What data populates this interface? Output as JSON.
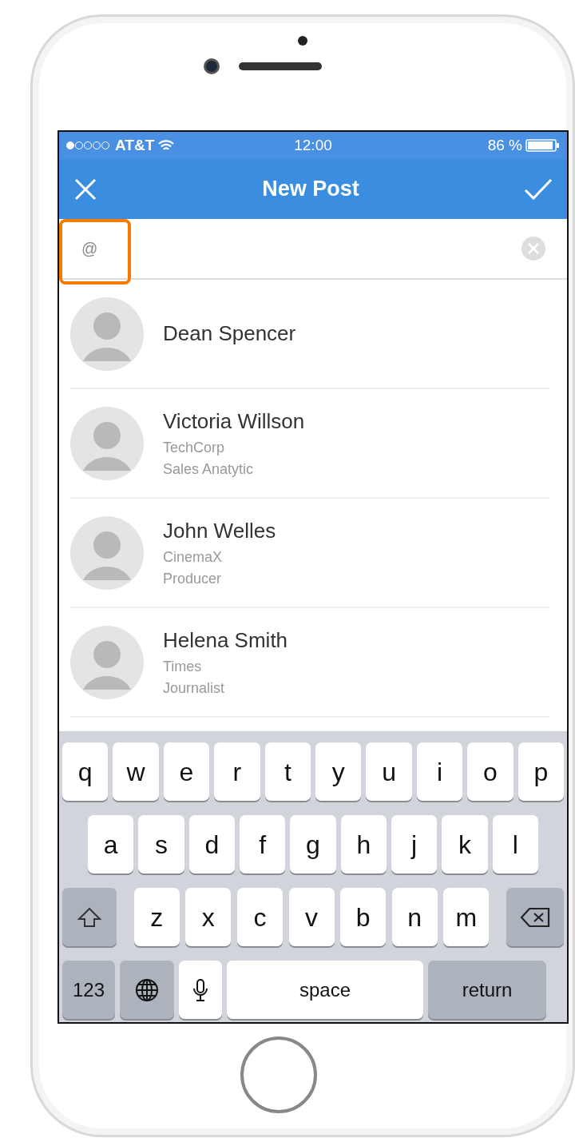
{
  "status_bar": {
    "carrier": "AT&T",
    "time": "12:00",
    "battery": "86 %"
  },
  "nav": {
    "title": "New Post"
  },
  "mention_field": {
    "value": "@",
    "highlighted": true
  },
  "contacts": [
    {
      "name": "Dean Spencer"
    },
    {
      "name": "Victoria Willson",
      "company": "TechCorp",
      "role": "Sales Anatytic"
    },
    {
      "name": "John Welles",
      "company": "CinemaX",
      "role": "Producer"
    },
    {
      "name": "Helena Smith",
      "company": "Times",
      "role": "Journalist"
    }
  ],
  "keyboard": {
    "rows": [
      {
        "keys": [
          {
            "kind": "letter",
            "label": "q"
          },
          {
            "kind": "letter",
            "label": "w"
          },
          {
            "kind": "letter",
            "label": "e"
          },
          {
            "kind": "letter",
            "label": "r"
          },
          {
            "kind": "letter",
            "label": "t"
          },
          {
            "kind": "letter",
            "label": "y"
          },
          {
            "kind": "letter",
            "label": "u"
          },
          {
            "kind": "letter",
            "label": "i"
          },
          {
            "kind": "letter",
            "label": "o"
          },
          {
            "kind": "letter",
            "label": "p"
          }
        ]
      },
      {
        "keys": [
          {
            "kind": "letter",
            "label": "a"
          },
          {
            "kind": "letter",
            "label": "s"
          },
          {
            "kind": "letter",
            "label": "d"
          },
          {
            "kind": "letter",
            "label": "f"
          },
          {
            "kind": "letter",
            "label": "g"
          },
          {
            "kind": "letter",
            "label": "h"
          },
          {
            "kind": "letter",
            "label": "j"
          },
          {
            "kind": "letter",
            "label": "k"
          },
          {
            "kind": "letter",
            "label": "l"
          }
        ]
      },
      {
        "keys": [
          {
            "kind": "shift"
          },
          {
            "kind": "letter",
            "label": "z"
          },
          {
            "kind": "letter",
            "label": "x"
          },
          {
            "kind": "letter",
            "label": "c"
          },
          {
            "kind": "letter",
            "label": "v"
          },
          {
            "kind": "letter",
            "label": "b"
          },
          {
            "kind": "letter",
            "label": "n"
          },
          {
            "kind": "letter",
            "label": "m"
          },
          {
            "kind": "delete"
          }
        ]
      },
      {
        "keys": [
          {
            "kind": "numbers",
            "label": "123"
          },
          {
            "kind": "globe"
          },
          {
            "kind": "mic"
          },
          {
            "kind": "space",
            "label": "space"
          },
          {
            "kind": "return",
            "label": "return"
          }
        ]
      }
    ]
  }
}
